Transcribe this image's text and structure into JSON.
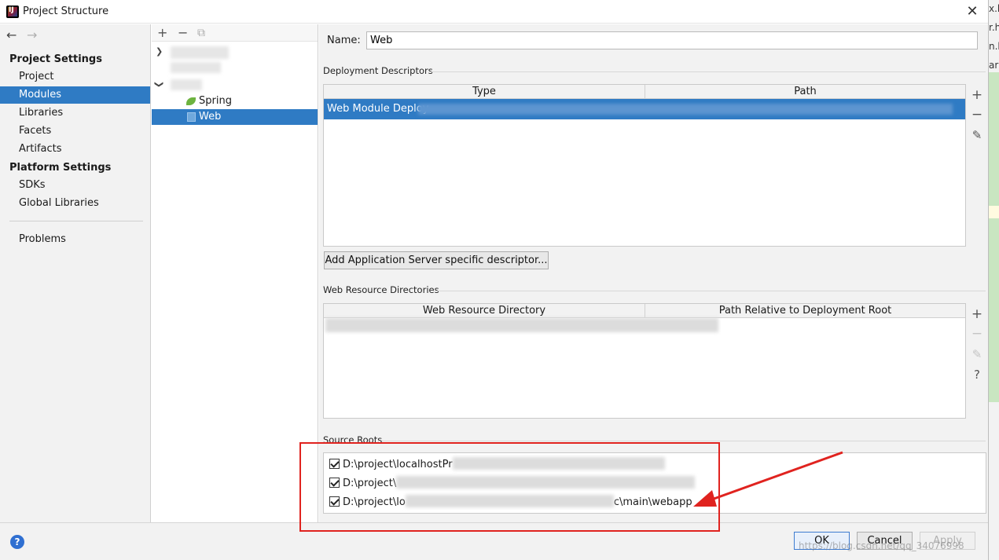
{
  "window": {
    "title": "Project Structure",
    "close": "✕"
  },
  "background_window": {
    "fragments": [
      "x.h",
      "r.ht",
      "n.h",
      "ar"
    ]
  },
  "nav": {
    "back": "←",
    "forward": "→"
  },
  "sidebar": {
    "project_settings": "Project Settings",
    "platform_settings": "Platform Settings",
    "items": [
      "Project",
      "Modules",
      "Libraries",
      "Facets",
      "Artifacts"
    ],
    "platform_items": [
      "SDKs",
      "Global Libraries"
    ],
    "problems": "Problems",
    "selected": "Modules"
  },
  "tree": {
    "toolbar": {
      "add": "+",
      "remove": "−",
      "copy": "⧉"
    },
    "nodes": [
      {
        "label": "Spring",
        "icon": "spring-icon"
      },
      {
        "label": "Web",
        "icon": "web-module-icon",
        "selected": true
      }
    ]
  },
  "main": {
    "name_label": "Name:",
    "name_value": "Web",
    "deployment": {
      "title": "Deployment Descriptors",
      "col_type": "Type",
      "col_path": "Path",
      "row_type": "Web Module Deploy",
      "tools": [
        "+",
        "−",
        "✎"
      ]
    },
    "add_descriptor_button": "Add Application Server specific descriptor...",
    "web_resources": {
      "title": "Web Resource Directories",
      "col_dir": "Web Resource Directory",
      "col_rel": "Path Relative to Deployment Root",
      "tools": [
        "+",
        "−",
        "✎",
        "?"
      ]
    },
    "source_roots": {
      "title": "Source Roots",
      "rows": [
        {
          "prefix": "D:\\project\\localhostPr",
          "suffix": ""
        },
        {
          "prefix": "D:\\project\\",
          "suffix": ""
        },
        {
          "prefix": "D:\\project\\lo",
          "suffix": "c\\main\\webapp"
        }
      ]
    }
  },
  "buttons": {
    "ok": "OK",
    "cancel": "Cancel",
    "apply": "Apply",
    "help": "?"
  },
  "watermark": "https://blog.csdn.net/qq_34076998",
  "colors": {
    "selection": "#2f7bc4",
    "annotation": "#e0231f",
    "accent_primary": "#3d7bd0"
  }
}
